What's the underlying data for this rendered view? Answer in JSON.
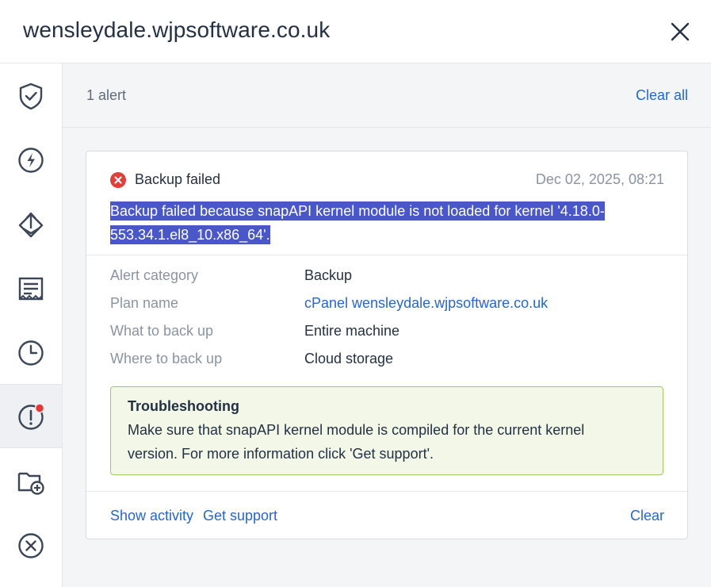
{
  "header": {
    "title": "wensleydale.wjpsoftware.co.uk"
  },
  "sidebar": {
    "items": [
      {
        "icon": "shield-check-icon"
      },
      {
        "icon": "lightning-icon"
      },
      {
        "icon": "recovery-icon"
      },
      {
        "icon": "ticket-icon"
      },
      {
        "icon": "clock-icon"
      },
      {
        "icon": "alert-icon",
        "active": true,
        "badge_color": "#e53935"
      },
      {
        "icon": "folder-add-icon"
      },
      {
        "icon": "cancel-circle-icon"
      }
    ]
  },
  "topbar": {
    "count": "1 alert",
    "clear_all": "Clear all"
  },
  "alert": {
    "status_icon": "error-icon",
    "status_color": "#e0403a",
    "title": "Backup failed",
    "timestamp": "Dec 02, 2025, 08:21",
    "message_line1": "Backup failed because snapAPI kernel module is not loaded for kernel '4.18.0-",
    "message_line2": "553.34.1.el8_10.x86_64'.",
    "details": [
      {
        "key": "Alert category",
        "value": "Backup"
      },
      {
        "key": "Plan name",
        "value": "cPanel wensleydale.wjpsoftware.co.uk"
      },
      {
        "key": "What to back up",
        "value": "Entire machine"
      },
      {
        "key": "Where to back up",
        "value": "Cloud storage"
      }
    ],
    "troubleshooting": {
      "title": "Troubleshooting",
      "line1": "Make sure that snapAPI kernel module is compiled for the current kernel",
      "line2": "version. For more information click 'Get support'."
    },
    "actions": {
      "show_activity": "Show activity",
      "get_support": "Get support",
      "clear": "Clear"
    }
  },
  "colors": {
    "accent": "#2668c5",
    "highlight": "#4a57c9",
    "tips_border": "#9fcb5f",
    "tips_bg": "#f2f7e8"
  }
}
